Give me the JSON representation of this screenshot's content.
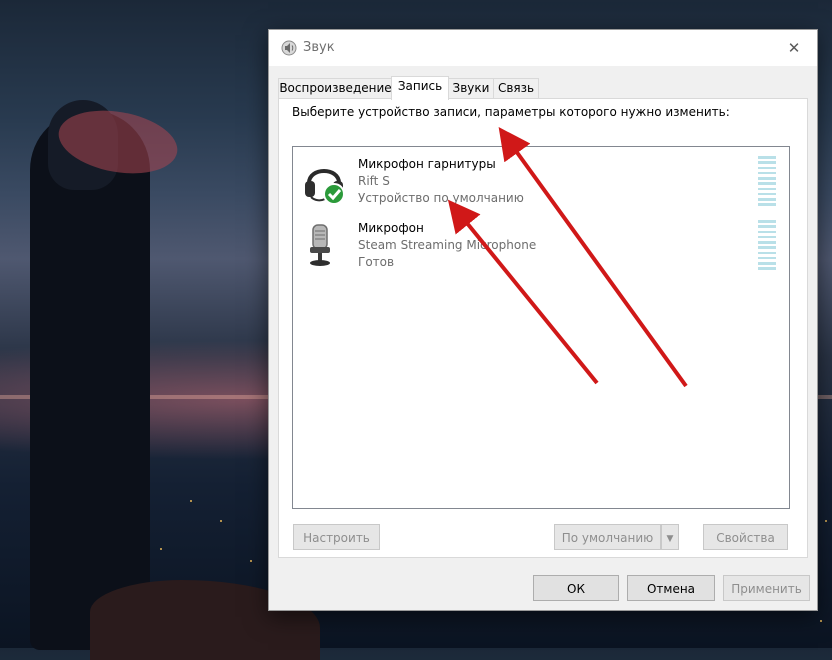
{
  "window": {
    "title": "Звук",
    "close_glyph": "✕"
  },
  "tabs": [
    {
      "label": "Воспроизведение",
      "active": false
    },
    {
      "label": "Запись",
      "active": true
    },
    {
      "label": "Звуки",
      "active": false
    },
    {
      "label": "Связь",
      "active": false
    }
  ],
  "recording": {
    "instruction": "Выберите устройство записи, параметры которого нужно изменить:",
    "devices": [
      {
        "name": "Микрофон гарнитуры",
        "description": "Rift S",
        "status": "Устройство по умолчанию",
        "icon": "headset-icon",
        "default_badge": "check-badge-icon"
      },
      {
        "name": "Микрофон",
        "description": "Steam Streaming Microphone",
        "status": "Готов",
        "icon": "microphone-icon"
      }
    ]
  },
  "buttons": {
    "configure": "Настроить",
    "set_default": "По умолчанию",
    "properties": "Свойства",
    "ok": "ОК",
    "cancel": "Отмена",
    "apply": "Применить"
  },
  "colors": {
    "annotation_arrow": "#d01818",
    "default_badge": "#2b9a3a",
    "level_meter": "#b9e0e8"
  }
}
